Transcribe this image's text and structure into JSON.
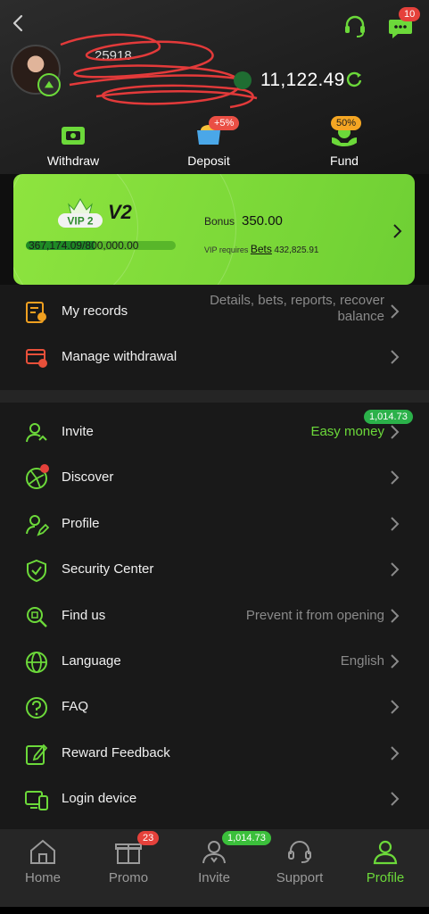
{
  "header": {
    "user_id_partial": "25918",
    "balance": "11,122.49",
    "message_badge": "10"
  },
  "quick_actions": [
    {
      "label": "Withdraw",
      "icon": "wallet-icon"
    },
    {
      "label": "Deposit",
      "icon": "deposit-icon",
      "badge": "+5%"
    },
    {
      "label": "Fund",
      "icon": "fund-icon",
      "badge": "50%"
    }
  ],
  "vip": {
    "emblem_text": "VIP 2",
    "level": "V2",
    "progress_text": "367,174.09/800,000.00",
    "progress_fraction": 0.459,
    "bonus_label": "Bonus",
    "bonus_value": "350.00",
    "requires_text": "VIP requires",
    "requires_link": "Bets",
    "requires_value": "432,825.91"
  },
  "menu_top": [
    {
      "title": "My records",
      "desc": "Details, bets, reports, recover balance"
    },
    {
      "title": "Manage withdrawal",
      "desc": ""
    }
  ],
  "menu_main": [
    {
      "title": "Invite",
      "desc": "Easy money",
      "badge": "1,014.73"
    },
    {
      "title": "Discover",
      "desc": ""
    },
    {
      "title": "Profile",
      "desc": ""
    },
    {
      "title": "Security Center",
      "desc": ""
    },
    {
      "title": "Find us",
      "desc": "Prevent it from opening"
    },
    {
      "title": "Language",
      "desc": "English"
    },
    {
      "title": "FAQ",
      "desc": ""
    },
    {
      "title": "Reward Feedback",
      "desc": ""
    },
    {
      "title": "Login device",
      "desc": ""
    }
  ],
  "nav": [
    {
      "label": "Home"
    },
    {
      "label": "Promo",
      "badge": "23"
    },
    {
      "label": "Invite",
      "badge": "1,014.73"
    },
    {
      "label": "Support"
    },
    {
      "label": "Profile"
    }
  ],
  "colors": {
    "accent": "#6cd93a",
    "badge_red": "#e5413b",
    "vip_card": "#8ee43f"
  }
}
